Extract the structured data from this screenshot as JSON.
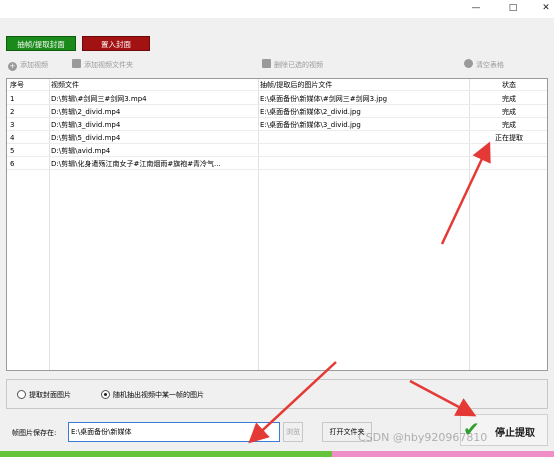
{
  "window": {
    "minimize_glyph": "—",
    "maximize_glyph": "□",
    "close_glyph": "✕"
  },
  "mode_tabs": {
    "extract_label": "抽帧/提取封面",
    "embed_label": "置入封面"
  },
  "toolbar": {
    "add_video": "添加视频",
    "add_folder": "添加视频文件夹",
    "delete_selected": "删除已选的视频",
    "clear_table": "清空表格",
    "icons": {
      "add_video": "plus-circle-icon",
      "add_folder": "folder-video-icon",
      "delete_selected": "video-delete-icon",
      "clear_table": "broom-icon"
    }
  },
  "table": {
    "headers": {
      "num": "序号",
      "video": "视频文件",
      "image": "抽帧/提取后的图片文件",
      "status": "状态"
    },
    "rows": [
      {
        "num": "1",
        "video": "D:\\剪辑\\#剑网三#剑网3.mp4",
        "image": "E:\\桌面备份\\新媒体\\#剑网三#剑网3.jpg",
        "status": "完成"
      },
      {
        "num": "2",
        "video": "D:\\剪辑\\2_divid.mp4",
        "image": "E:\\桌面备份\\新媒体\\2_divid.jpg",
        "status": "完成"
      },
      {
        "num": "3",
        "video": "D:\\剪辑\\3_divid.mp4",
        "image": "E:\\桌面备份\\新媒体\\3_divid.jpg",
        "status": "完成"
      },
      {
        "num": "4",
        "video": "D:\\剪辑\\5_divid.mp4",
        "image": "",
        "status": "正在提取"
      },
      {
        "num": "5",
        "video": "D:\\剪辑\\avid.mp4",
        "image": "",
        "status": ""
      },
      {
        "num": "6",
        "video": "D:\\剪辑\\化身遣殇江南女子#江南烟雨#旗袍#青冷气...",
        "image": "",
        "status": ""
      }
    ]
  },
  "options": {
    "extract_cover": "提取封面图片",
    "random_frame": "随机抽出视频中某一帧的图片",
    "selected": "random_frame"
  },
  "save": {
    "label": "帧图片保存在:",
    "path": "E:\\桌面备份\\新媒体",
    "browse": "浏览",
    "open_folder": "打开文件夹"
  },
  "action": {
    "stop_label": "停止提取"
  },
  "watermark": "CSDN @hby920967810",
  "colors": {
    "extract_tab": "#1a8a1a",
    "embed_tab": "#a31212",
    "arrow": "#e53935",
    "progress_done": "#66c43a",
    "progress_rest": "#f08ec8"
  }
}
